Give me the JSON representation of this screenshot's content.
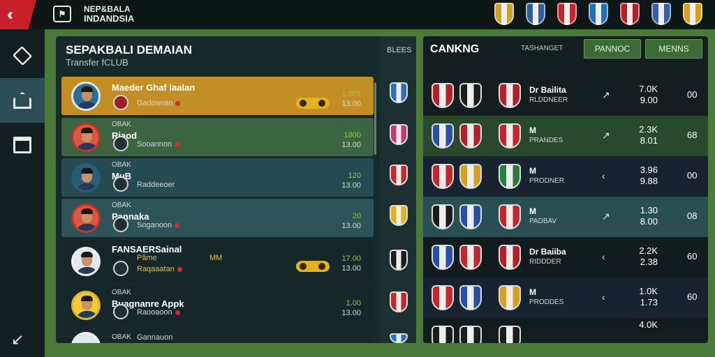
{
  "topbar": {
    "back_icon": "double-chevron-left-icon",
    "title_line1": "NEP&BALA",
    "title_line2": "INDANDSIA",
    "crest_colors": [
      "#c9a227",
      "#2f5e9e",
      "#c1272d",
      "#1f6fb2",
      "#b51f2a",
      "#3a5fa0",
      "#d4a020"
    ]
  },
  "nav": {
    "items": [
      {
        "icon": "cube-icon",
        "active": false
      },
      {
        "icon": "home-icon",
        "active": true
      },
      {
        "icon": "shop-icon",
        "active": false
      }
    ],
    "exit_icon": "exit-icon"
  },
  "transfer": {
    "title": "SEPAKBALI DEMAIAN",
    "subtitle": "Transfer fCLUB",
    "club_column_label": "BLEES",
    "players": [
      {
        "tag": "",
        "name": "Maeder Ghaf laalan",
        "role": "Gadoanan",
        "value": "1.001",
        "value_sub": "13.00"
      },
      {
        "tag": "OBAK",
        "name": "Riaod",
        "role": "Sooannon",
        "value": "1800",
        "value_sub": "13.00"
      },
      {
        "tag": "OBAK",
        "name": "MuB",
        "role": "Raddeeoer",
        "value": "120",
        "value_sub": "13.00"
      },
      {
        "tag": "OBAK",
        "name": "Pannaka",
        "role": "Soganoon",
        "value": "20",
        "value_sub": "13.00"
      },
      {
        "tag": "",
        "name": "FANSAERSainal",
        "role": "Raqaaatan",
        "extra1": "Pâme",
        "extra2": "MM",
        "value": "17.00",
        "value_sub": "13.00"
      },
      {
        "tag": "OBAK",
        "name": "Buagnanre Appk",
        "role": "Raooaoon",
        "value": "1.00",
        "value_sub": "13.00"
      },
      {
        "tag": "OBAK",
        "name": "Gannauon",
        "role": "",
        "value": "",
        "value_sub": ""
      }
    ],
    "side_crest_colors": [
      "#2c6fb8",
      "#c4397a",
      "#c02a2a",
      "#e0b21e",
      "#1c1c1c",
      "#c02a2a",
      "#2c6fb8"
    ]
  },
  "ranking": {
    "title": "CANKNG",
    "subtitle": "TASHANGET",
    "tab1": "PANNOC",
    "tab2": "MENNS",
    "rows": [
      {
        "name": "Dr Bailita",
        "sub": "RLDDNEER",
        "arrow": "↗",
        "score1": "7.0K",
        "score2": "9.00",
        "pts": "00",
        "crests": [
          "#b51f2a",
          "#1c1c1c",
          "#b51f2a"
        ]
      },
      {
        "name": "M",
        "sub": "PRANDES",
        "arrow": "↗",
        "score1": "2.3K",
        "score2": "8.01",
        "pts": "68",
        "crests": [
          "#2a4fa0",
          "#b51f2a",
          "#c1272d"
        ]
      },
      {
        "name": "M",
        "sub": "PRODNER",
        "arrow": "‹",
        "score1": "3.96",
        "score2": "9.88",
        "pts": "00",
        "crests": [
          "#c1272d",
          "#d4a020",
          "#2f7a3a"
        ]
      },
      {
        "name": "M",
        "sub": "PADBAV",
        "arrow": "↗",
        "score1": "1.30",
        "score2": "8.00",
        "pts": "08",
        "crests": [
          "#1c1c1c",
          "#2a4fa0",
          "#c1272d"
        ]
      },
      {
        "name": "Dr Baiiba",
        "sub": "RIDDDER",
        "arrow": "‹",
        "score1": "2.2K",
        "score2": "2.38",
        "pts": "60",
        "crests": [
          "#2a4fa0",
          "#c1272d",
          "#b51f2a"
        ]
      },
      {
        "name": "M",
        "sub": "PRODDES",
        "arrow": "‹",
        "score1": "1.0K",
        "score2": "1.73",
        "pts": "60",
        "crests": [
          "#c1272d",
          "#2a4fa0",
          "#d4a020"
        ]
      },
      {
        "name": "",
        "sub": "",
        "arrow": "",
        "score1": "4.0K",
        "score2": "",
        "pts": "",
        "crests": [
          "#1c1c1c",
          "#1c1c1c",
          "#1c1c1c"
        ]
      }
    ]
  }
}
